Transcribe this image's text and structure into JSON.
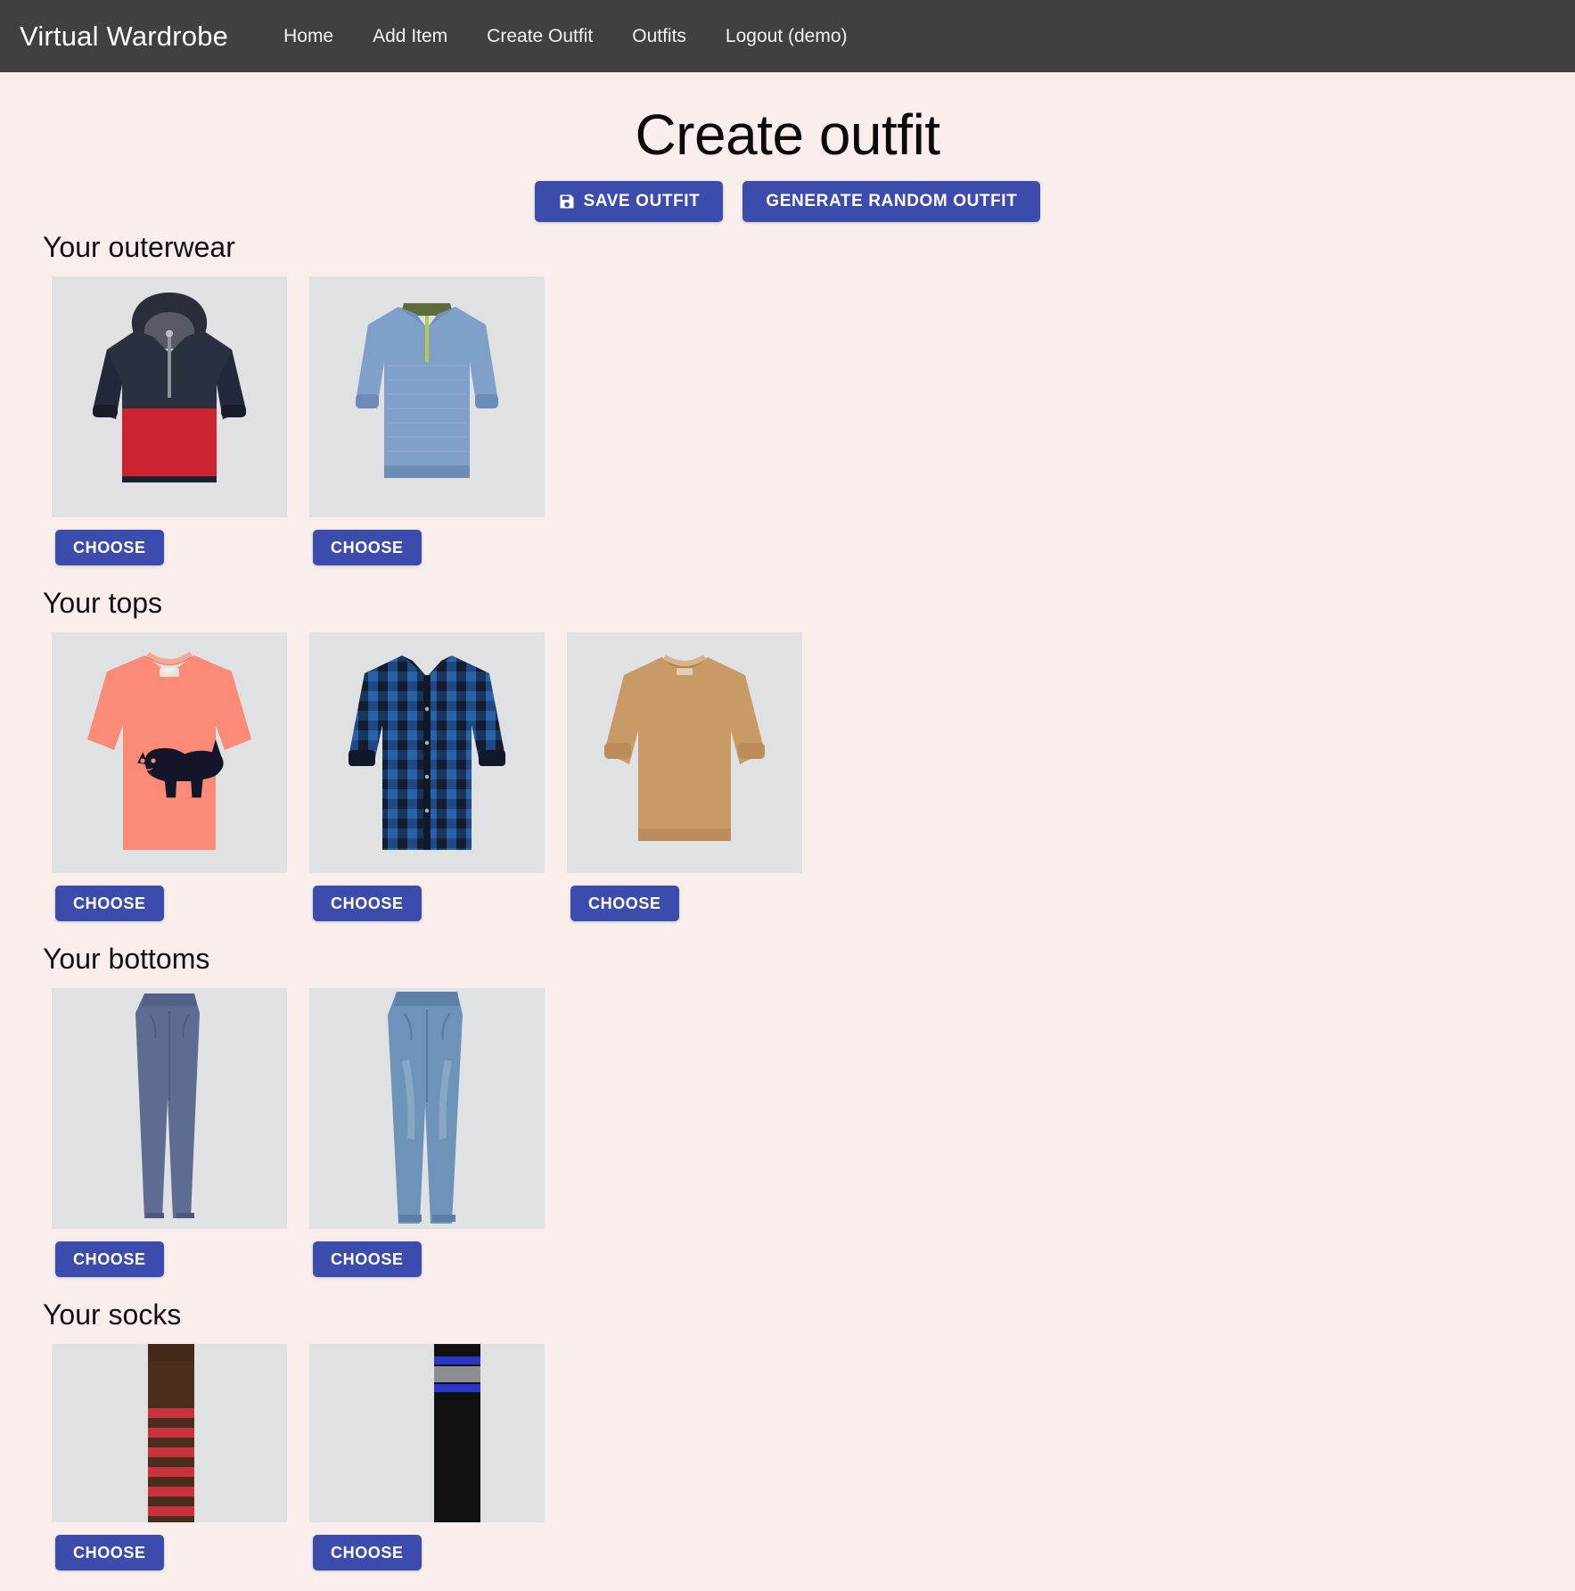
{
  "navbar": {
    "brand": "Virtual Wardrobe",
    "links": [
      {
        "label": "Home",
        "name": "nav-link-home"
      },
      {
        "label": "Add Item",
        "name": "nav-link-add-item"
      },
      {
        "label": "Create Outfit",
        "name": "nav-link-create-outfit"
      },
      {
        "label": "Outfits",
        "name": "nav-link-outfits"
      },
      {
        "label": "Logout (demo)",
        "name": "nav-link-logout"
      }
    ],
    "background_color": "#433f3d",
    "text_color": "#ffffff"
  },
  "page": {
    "title": "Create outfit",
    "background_color": "#faeeec"
  },
  "actions": {
    "save_label": "SAVE OUTFIT",
    "save_icon": "floppy-disk-icon",
    "random_label": "GENERATE RANDOM OUTFIT",
    "button_color": "#3c4cad"
  },
  "sections": {
    "outerwear": {
      "heading": "Your outerwear",
      "items": [
        {
          "choose_label": "CHOOSE",
          "description": "navy and red colorblock hooded anorak jacket"
        },
        {
          "choose_label": "CHOOSE",
          "description": "light blue knitted blouson jacket"
        }
      ]
    },
    "tops": {
      "heading": "Your tops",
      "items": [
        {
          "choose_label": "CHOOSE",
          "description": "coral t-shirt with black cat graphic"
        },
        {
          "choose_label": "CHOOSE",
          "description": "blue and black check flannel shirt"
        },
        {
          "choose_label": "CHOOSE",
          "description": "camel crew neck sweatshirt"
        }
      ]
    },
    "bottoms": {
      "heading": "Your bottoms",
      "items": [
        {
          "choose_label": "CHOOSE",
          "description": "slate blue slim chino trousers"
        },
        {
          "choose_label": "CHOOSE",
          "description": "medium wash blue jeans"
        }
      ]
    },
    "socks": {
      "heading": "Your socks",
      "items": [
        {
          "choose_label": "CHOOSE",
          "description": "brown and red striped socks"
        },
        {
          "choose_label": "CHOOSE",
          "description": "black socks with blue and grey stripes"
        }
      ]
    }
  },
  "colors": {
    "thumb_background": "#dfe1e3",
    "accent": "#3c4cad"
  }
}
